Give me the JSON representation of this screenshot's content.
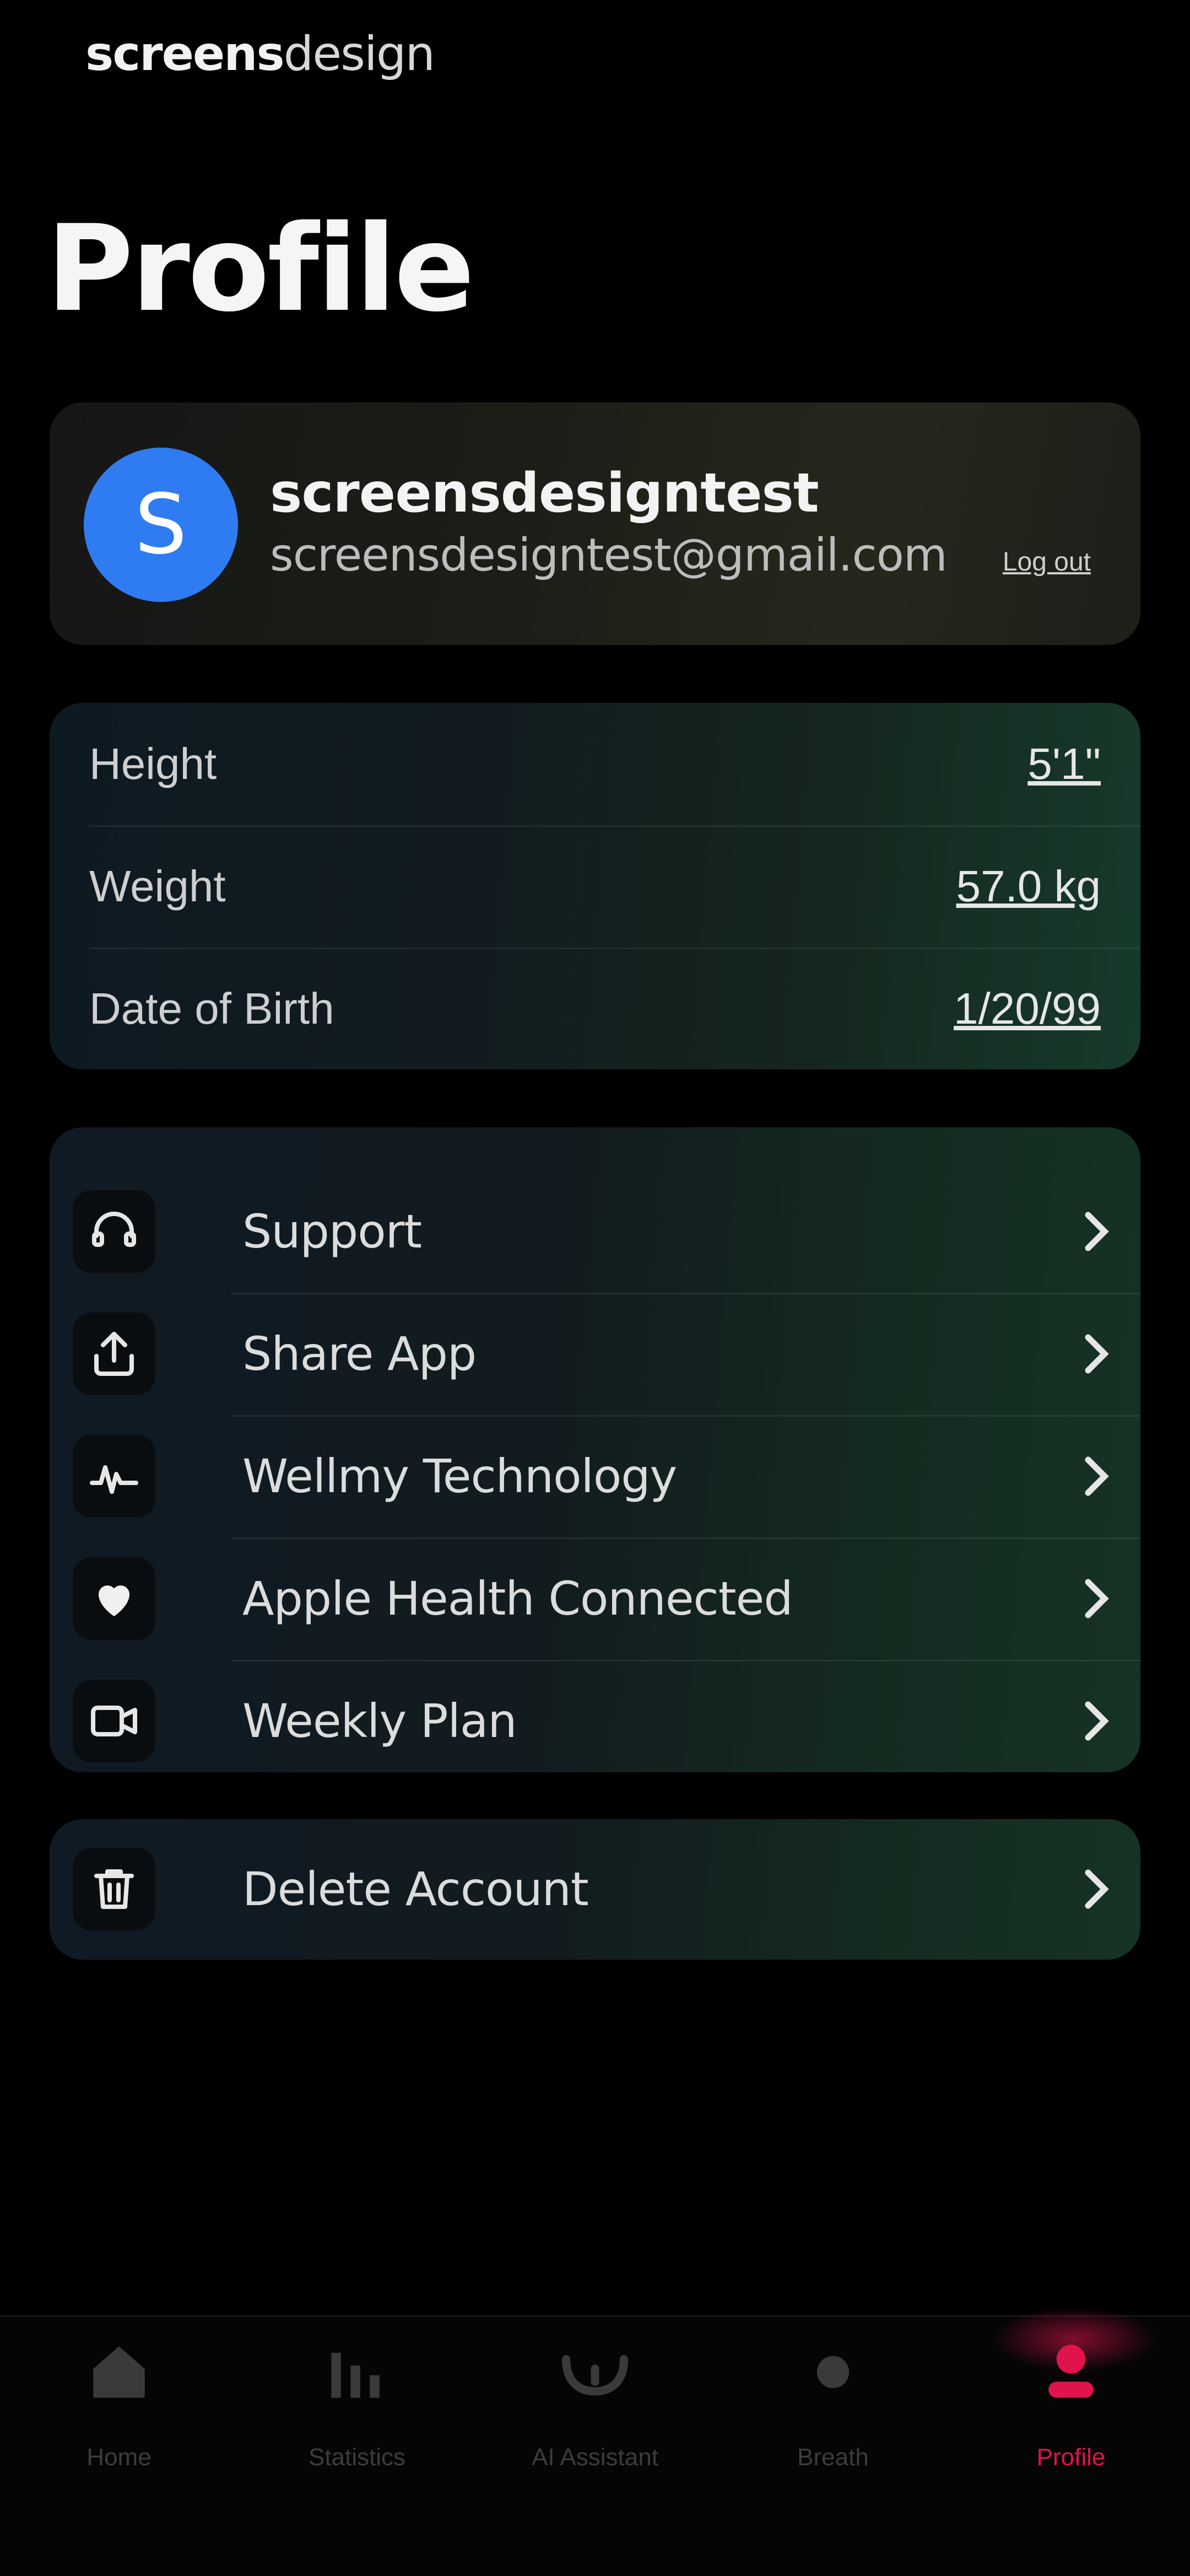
{
  "brand": {
    "bold": "screens",
    "light": "design"
  },
  "page_title": "Profile",
  "profile": {
    "avatar_letter": "S",
    "name": "screensdesigntest",
    "email": "screensdesigntest@gmail.com",
    "logout_label": "Log out",
    "avatar_color": "#2f7cf2"
  },
  "metrics": [
    {
      "label": "Height",
      "value": "5'1\""
    },
    {
      "label": "Weight",
      "value": "57.0 kg"
    },
    {
      "label": "Date of Birth",
      "value": "1/20/99"
    }
  ],
  "menu": [
    {
      "label": "Support",
      "icon": "headset-icon"
    },
    {
      "label": "Share App",
      "icon": "share-icon"
    },
    {
      "label": "Wellmy Technology",
      "icon": "pulse-icon"
    },
    {
      "label": "Apple Health Connected",
      "icon": "heart-icon"
    },
    {
      "label": "Weekly Plan",
      "icon": "video-icon"
    }
  ],
  "delete": {
    "label": "Delete Account",
    "icon": "trash-icon"
  },
  "tabs": [
    {
      "label": "Home",
      "icon": "home-icon"
    },
    {
      "label": "Statistics",
      "icon": "bar-chart-icon"
    },
    {
      "label": "AI Assistant",
      "icon": "ai-icon"
    },
    {
      "label": "Breath",
      "icon": "breath-icon"
    },
    {
      "label": "Profile",
      "icon": "profile-icon",
      "active": true
    }
  ],
  "colors": {
    "accent": "#e0134d",
    "background": "#000000"
  }
}
